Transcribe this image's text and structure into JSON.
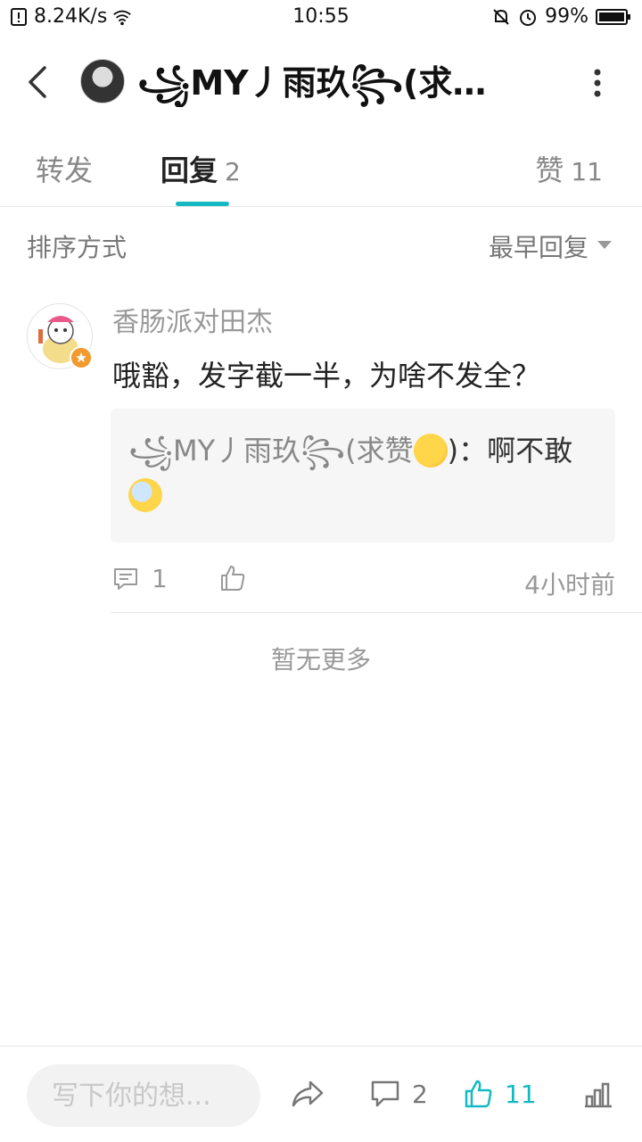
{
  "status_bar": {
    "speed": "8.24K/s",
    "time": "10:55",
    "battery": "99%"
  },
  "header": {
    "title": "꧁MY丿雨玖꧂(求…",
    "icons": [
      "back-icon",
      "avatar",
      "more-vertical-icon"
    ]
  },
  "tabs": [
    {
      "label": "转发",
      "count": ""
    },
    {
      "label": "回复",
      "count": "2"
    },
    {
      "label": "赞",
      "count": "11"
    }
  ],
  "sort": {
    "label": "排序方式",
    "value": "最早回复"
  },
  "reply": {
    "username": "香肠派对田杰",
    "text": "哦豁，发字截一半，为啥不发全？",
    "quote_author": "꧁MY丿雨玖꧂(求赞",
    "quote_suffix": ")：啊不敢",
    "comment_count": "1",
    "time": "4小时前"
  },
  "no_more": "暂无更多",
  "bottom_bar": {
    "input_placeholder": "写下你的想...",
    "comment_count": "2",
    "like_count": "11"
  },
  "colors": {
    "accent": "#15b9c4",
    "muted": "#999999"
  }
}
